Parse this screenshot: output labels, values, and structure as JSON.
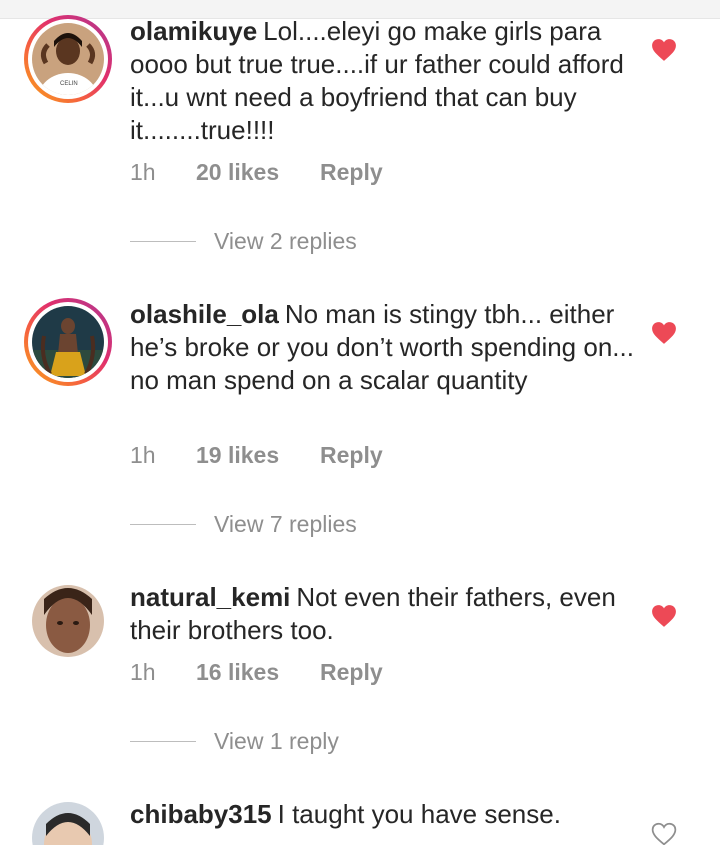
{
  "comments": [
    {
      "username": "olamikuye",
      "text": "Lol....eleyi go make girls para oooo but true true....if ur father could afford it...u wnt  need a boyfriend that can buy it........true!!!!",
      "time": "1h",
      "likes": "20 likes",
      "reply_label": "Reply",
      "view_replies": "View 2 replies",
      "liked": true,
      "avatar_text": "CELIN"
    },
    {
      "username": "olashile_ola",
      "text": "No man is stingy tbh... either he’s broke or you don’t worth spending on... no man spend on a scalar quantity",
      "time": "1h",
      "likes": "19 likes",
      "reply_label": "Reply",
      "view_replies": "View 7 replies",
      "liked": true
    },
    {
      "username": "natural_kemi",
      "text": "Not even their fathers, even their brothers too.",
      "time": "1h",
      "likes": "16 likes",
      "reply_label": "Reply",
      "view_replies": "View 1 reply",
      "liked": true
    },
    {
      "username": "chibaby315",
      "text": "I taught you have sense.",
      "liked": false
    }
  ],
  "colors": {
    "heart_liked": "#ed4956",
    "heart_outline": "#8e8e8e",
    "muted_text": "#8e8e8e",
    "primary_text": "#262626"
  }
}
